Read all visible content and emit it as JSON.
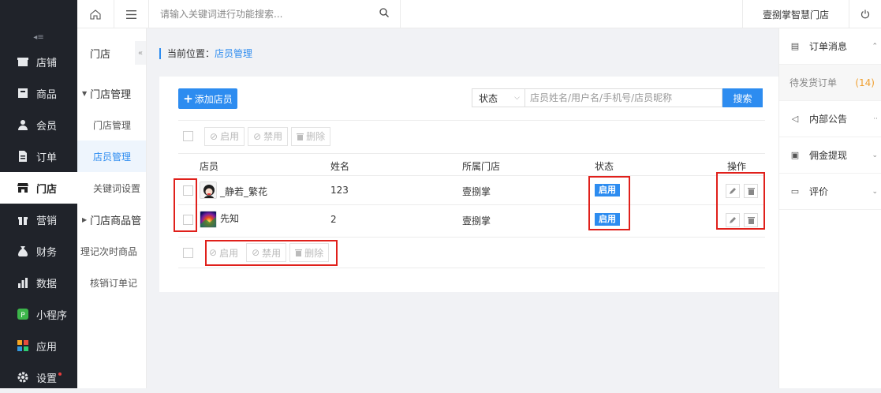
{
  "topbar": {
    "search_placeholder": "请输入关键词进行功能搜索...",
    "store_name": "壹捌掌智慧门店"
  },
  "leftnav": {
    "items": [
      {
        "label": "店铺",
        "icon": "shop-icon"
      },
      {
        "label": "商品",
        "icon": "goods-icon"
      },
      {
        "label": "会员",
        "icon": "user-icon"
      },
      {
        "label": "订单",
        "icon": "order-icon"
      },
      {
        "label": "门店",
        "icon": "store-icon",
        "active": true
      },
      {
        "label": "营销",
        "icon": "gift-icon"
      },
      {
        "label": "财务",
        "icon": "money-bag-icon"
      },
      {
        "label": "数据",
        "icon": "bar-chart-icon"
      },
      {
        "label": "小程序",
        "icon": "mini-program-icon"
      },
      {
        "label": "应用",
        "icon": "apps-icon"
      },
      {
        "label": "设置",
        "icon": "gear-icon"
      }
    ]
  },
  "subnav": {
    "title": "门店",
    "group1": "门店管理",
    "item1": "门店管理",
    "item2": "店员管理",
    "item3": "关键词设置",
    "group2": "门店商品管",
    "item4": "理记次时商品",
    "item5": "核销订单记"
  },
  "breadcrumb": {
    "prefix": "当前位置：",
    "current": "店员管理"
  },
  "toolbar": {
    "add_label": "添加店员",
    "status_select": "状态",
    "keyword_placeholder": "店员姓名/用户名/手机号/店员昵称",
    "search_label": "搜索"
  },
  "bulk": {
    "enable": "启用",
    "disable": "禁用",
    "delete": "删除"
  },
  "table": {
    "headers": {
      "staff": "店员",
      "name": "姓名",
      "store": "所属门店",
      "status": "状态",
      "ops": "操作"
    },
    "rows": [
      {
        "nickname": "_静若_繁花",
        "name": "123",
        "store": "壹捌掌",
        "status": "启用"
      },
      {
        "nickname": "先知",
        "name": "2",
        "store": "壹捌掌",
        "status": "启用"
      }
    ]
  },
  "rightpanel": {
    "order_msg": "订单消息",
    "pending": "待发货订单",
    "pending_count": "(14)",
    "notice": "内部公告",
    "commission": "佣金提现",
    "review": "评价"
  },
  "colors": {
    "accent": "#2d8cf0",
    "nav_bg": "#20232a",
    "highlight": "#e0201b"
  }
}
